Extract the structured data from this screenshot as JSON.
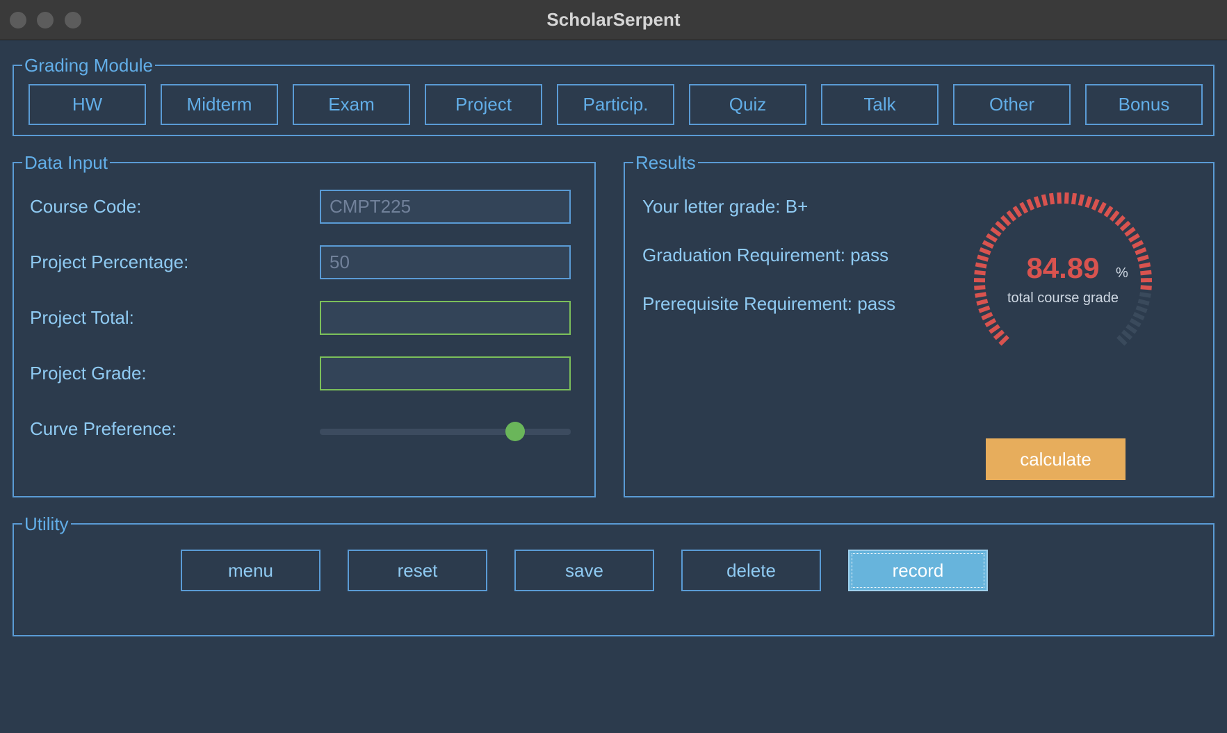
{
  "window": {
    "title": "ScholarSerpent"
  },
  "grading_module": {
    "legend": "Grading Module",
    "buttons": [
      "HW",
      "Midterm",
      "Exam",
      "Project",
      "Particip.",
      "Quiz",
      "Talk",
      "Other",
      "Bonus"
    ]
  },
  "data_input": {
    "legend": "Data Input",
    "course_code_label": "Course Code:",
    "course_code_placeholder": "CMPT225",
    "project_percentage_label": "Project Percentage:",
    "project_percentage_placeholder": "50",
    "project_total_label": "Project Total:",
    "project_total_value": "",
    "project_grade_label": "Project Grade:",
    "project_grade_value": "",
    "curve_preference_label": "Curve Preference:",
    "curve_preference_fraction": 0.74
  },
  "results": {
    "legend": "Results",
    "letter_grade": "Your letter grade: B+",
    "graduation": "Graduation Requirement: pass",
    "prerequisite": "Prerequisite Requirement: pass",
    "gauge": {
      "value": "84.89",
      "value_fraction": 0.8489,
      "unit": "%",
      "caption": "total course grade",
      "fill_color": "#d9534f",
      "track_color": "#3a4a5c"
    },
    "calculate_label": "calculate"
  },
  "utility": {
    "legend": "Utility",
    "buttons": [
      "menu",
      "reset",
      "save",
      "delete",
      "record"
    ]
  },
  "colors": {
    "background": "#2c3b4d",
    "accent": "#5a9bd5",
    "label_text": "#8fcaf2",
    "success_border": "#7cc05a",
    "calculate": "#e7ad5c",
    "active_button": "#67b4dc"
  }
}
